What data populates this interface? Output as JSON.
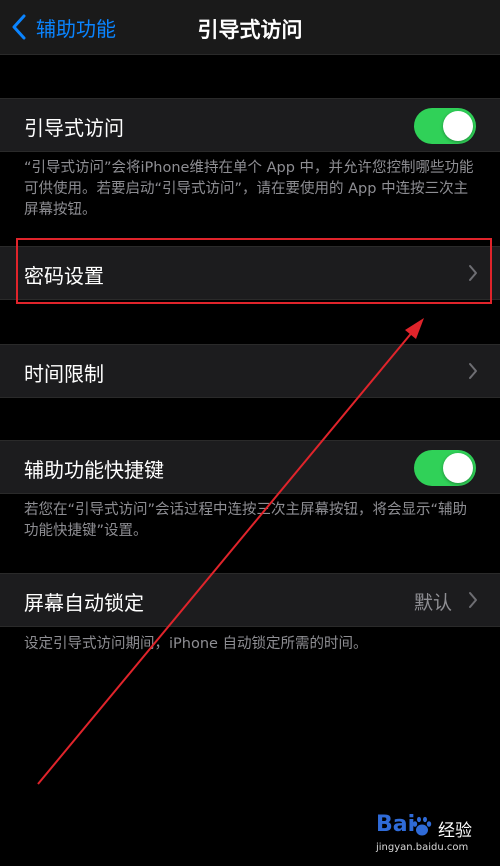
{
  "nav": {
    "back_label": "辅助功能",
    "title": "引导式访问"
  },
  "guided_access": {
    "label": "引导式访问",
    "enabled": true,
    "footer": "“引导式访问”会将iPhone维持在单个 App 中，并允许您控制哪些功能可供使用。若要启动“引导式访问”，请在要使用的 App 中连按三次主屏幕按钮。"
  },
  "passcode": {
    "label": "密码设置"
  },
  "time_limits": {
    "label": "时间限制"
  },
  "shortcut": {
    "label": "辅助功能快捷键",
    "enabled": true,
    "footer": "若您在“引导式访问”会话过程中连按三次主屏幕按钮，将会显示“辅助功能快捷键”设置。"
  },
  "auto_lock": {
    "label": "屏幕自动锁定",
    "value": "默认",
    "footer": "设定引导式访问期间，iPhone 自动锁定所需的时间。"
  },
  "watermark": {
    "brand_left": "Bai",
    "brand_right": "经验",
    "url": "jingyan.baidu.com"
  },
  "colors": {
    "accent": "#0a84ff",
    "toggle_on": "#30d158",
    "highlight": "#e0242b",
    "row_bg": "#1c1c1e",
    "secondary_text": "#8e8e93"
  },
  "icons": {
    "back": "chevron-left-icon",
    "disclosure": "chevron-right-icon",
    "watermark_logo": "baidu-paw-icon"
  }
}
